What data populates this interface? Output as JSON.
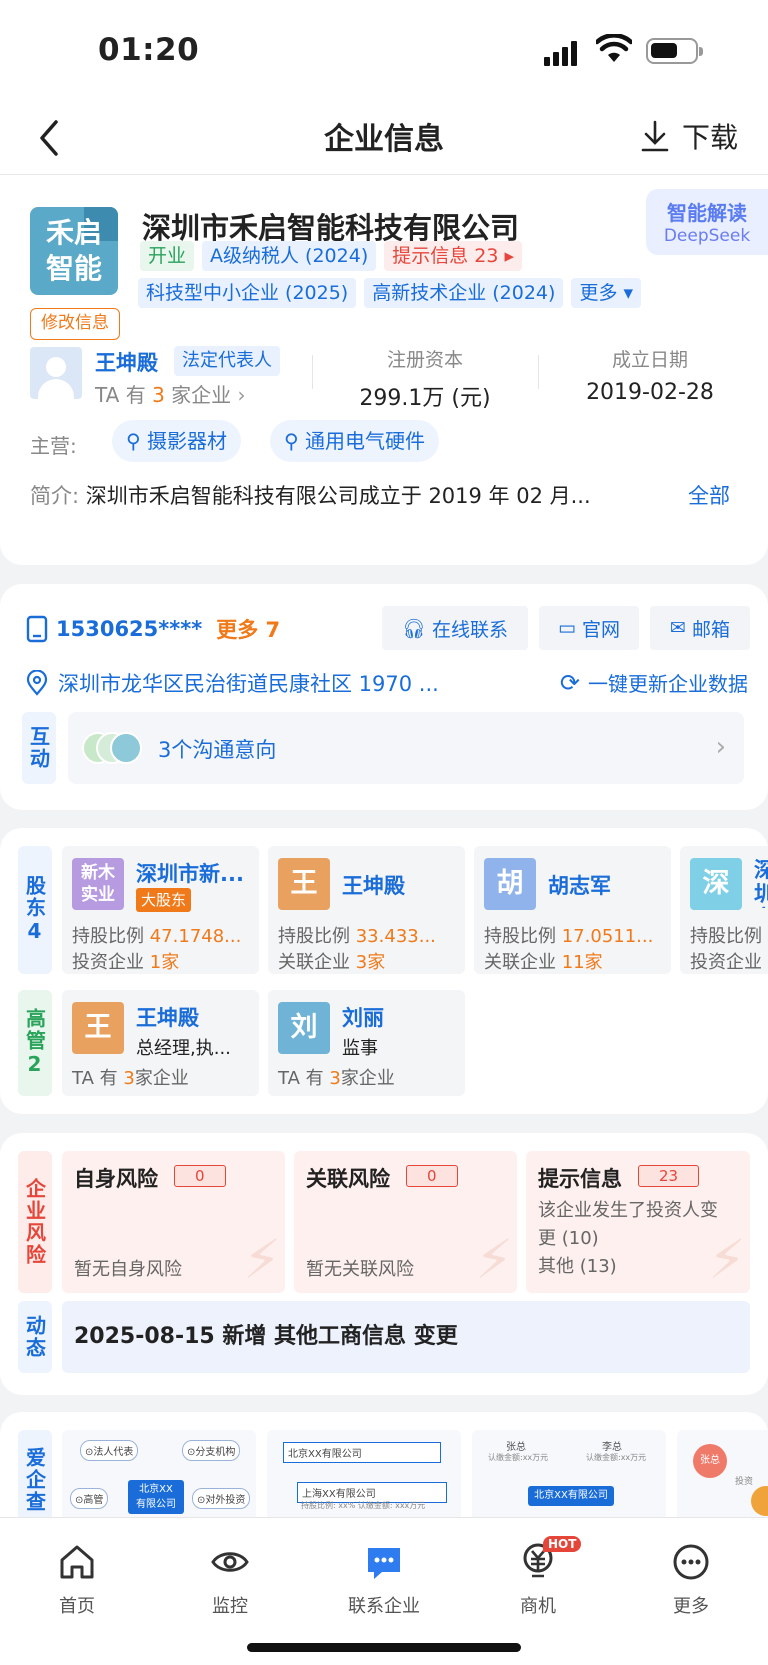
{
  "status_bar": {
    "time": "01:20"
  },
  "nav": {
    "title": "企业信息",
    "download": "下载"
  },
  "company": {
    "logo_text": "禾启\n智能",
    "name": "深圳市禾启智能科技有限公司",
    "edit_label": "修改信息",
    "ai": {
      "line1": "智能解读",
      "line2": "DeepSeek"
    },
    "tags_row1": [
      {
        "text": "开业",
        "style": "green"
      },
      {
        "text": "A级纳税人 (2024)",
        "style": "blue"
      },
      {
        "text": "提示信息 23 ▸",
        "style": "red"
      }
    ],
    "tags_row2": [
      {
        "text": "科技型中小企业 (2025)",
        "style": "blue"
      },
      {
        "text": "高新技术企业 (2024)",
        "style": "blue"
      },
      {
        "text": "更多 ▾",
        "style": "blue"
      }
    ],
    "legal_rep": {
      "name": "王坤殿",
      "badge": "法定代表人",
      "sub_prefix": "TA 有 ",
      "sub_count": "3",
      "sub_suffix": " 家企业"
    },
    "capital": {
      "label": "注册资本",
      "value": "299.1万 (元)"
    },
    "founded": {
      "label": "成立日期",
      "value": "2019-02-28"
    },
    "business_label": "主营:",
    "business": [
      "摄影器材",
      "通用电气硬件"
    ],
    "intro_label": "简介:",
    "intro_text": "深圳市禾启智能科技有限公司成立于 2019 年 02 月...",
    "intro_all": "全部"
  },
  "contact": {
    "phone": "1530625****",
    "phone_more": "更多 7",
    "buttons": [
      "在线联系",
      "官网",
      "邮箱"
    ],
    "address": "深圳市龙华区民治街道民康社区 1970 ...",
    "update": "一键更新企业数据",
    "interact_label": "互动",
    "interact_text": "3个沟通意向"
  },
  "shareholders": {
    "label": "股东4",
    "items": [
      {
        "avatar": "新木实业",
        "color": "#b69be0",
        "name": "深圳市新...",
        "badge": "大股东",
        "ratio_label": "持股比例",
        "ratio": "47.1748...",
        "inv_label": "投资企业",
        "inv_count": "1",
        "inv_unit": "家"
      },
      {
        "avatar": "王",
        "color": "#e8a15e",
        "name": "王坤殿",
        "badge": "",
        "ratio_label": "持股比例",
        "ratio": "33.433...",
        "inv_label": "关联企业",
        "inv_count": "3",
        "inv_unit": "家"
      },
      {
        "avatar": "胡",
        "color": "#8fb3ea",
        "name": "胡志军",
        "badge": "",
        "ratio_label": "持股比例",
        "ratio": "17.0511...",
        "inv_label": "关联企业",
        "inv_count": "11",
        "inv_unit": "家"
      },
      {
        "avatar": "深",
        "color": "#7fd0e6",
        "name": "深圳市",
        "badge": "",
        "ratio_label": "持股比例",
        "ratio": "",
        "inv_label": "投资企业",
        "inv_count": "",
        "inv_unit": ""
      }
    ]
  },
  "managers": {
    "label": "高管2",
    "items": [
      {
        "avatar": "王",
        "color": "#e8a15e",
        "name": "王坤殿",
        "role": "总经理,执...",
        "ta": "TA 有 ",
        "count": "3",
        "suffix": "家企业"
      },
      {
        "avatar": "刘",
        "color": "#6fb3d6",
        "name": "刘丽",
        "role": "监事",
        "ta": "TA 有 ",
        "count": "3",
        "suffix": "家企业"
      }
    ]
  },
  "risk": {
    "label": "企业风险",
    "items": [
      {
        "title": "自身风险",
        "count": "0",
        "desc": "暂无自身风险"
      },
      {
        "title": "关联风险",
        "count": "0",
        "desc": "暂无关联风险"
      },
      {
        "title": "提示信息",
        "count": "23",
        "line1": "该企业发生了投资人变更 (10)",
        "line2": "其他 (13)"
      }
    ],
    "dynamic_label": "动态",
    "dynamic_text": "2025-08-15 新增 其他工商信息 变更"
  },
  "graph": {
    "label": "爱企查",
    "t1": {
      "center": "北京XX\n有限公司",
      "n1": "⊙法人代表",
      "n2": "⊙分支机构",
      "n3": "⊙高管",
      "n4": "⊙对外投资"
    },
    "t2": {
      "a": "北京XX有限公司",
      "b": "上海XX有限公司",
      "c": "持股比例: xx%  认缴金额: xxx万元"
    },
    "t3": {
      "p1": "张总",
      "p2": "李总",
      "s1": "认缴金额:xx万元",
      "s2": "认缴金额:xx万元",
      "center": "北京XX有限公司"
    },
    "t4": {
      "p1": "张总",
      "p2": "投资"
    }
  },
  "tabbar": {
    "tabs": [
      "首页",
      "监控",
      "联系企业",
      "商机",
      "更多"
    ],
    "hot": "HOT"
  }
}
